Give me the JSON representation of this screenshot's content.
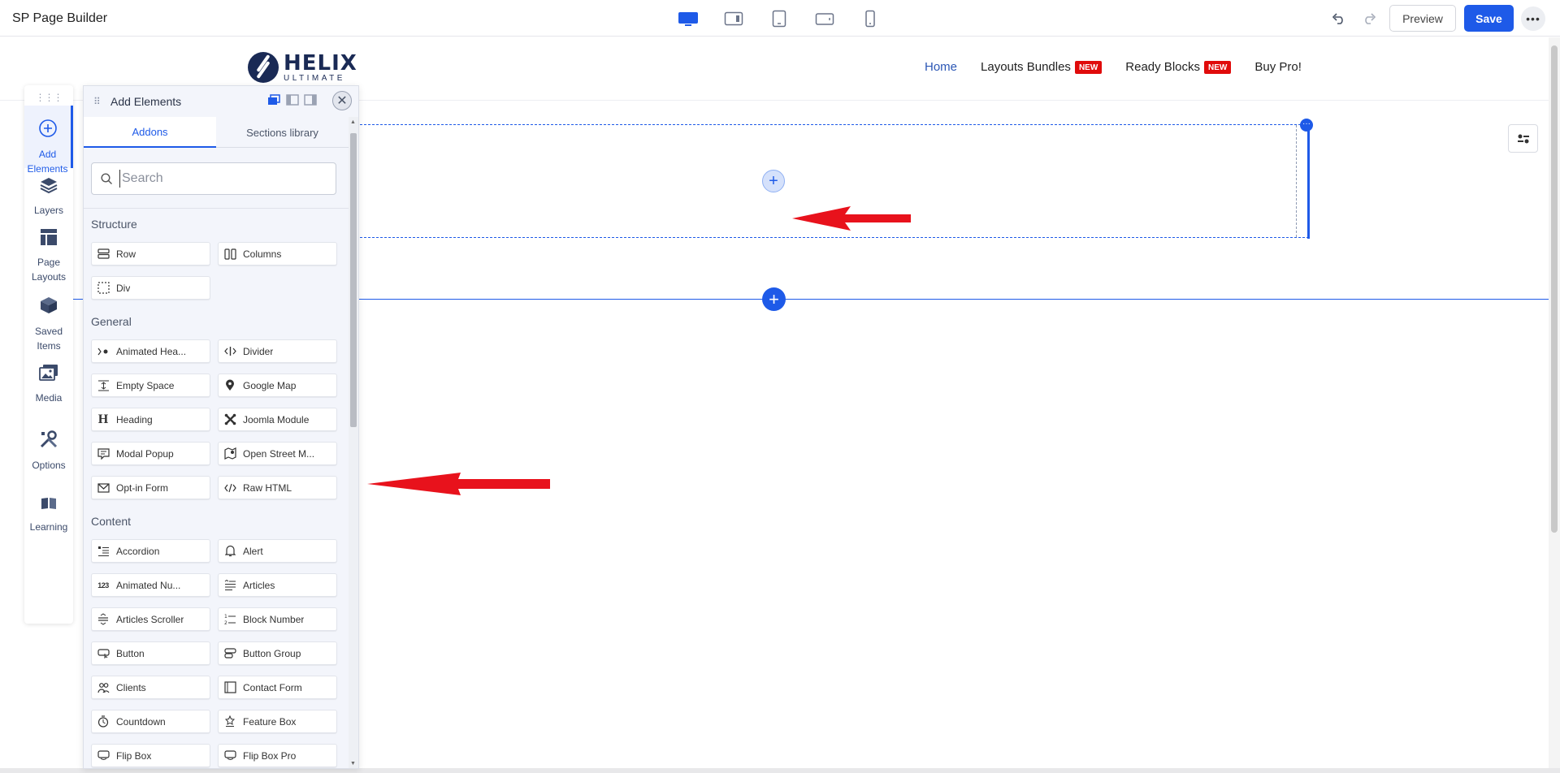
{
  "app": {
    "title": "SP Page Builder"
  },
  "toolbar": {
    "devices": [
      "desktop-icon",
      "laptop-icon",
      "tablet-icon",
      "tablet-landscape-icon",
      "mobile-icon"
    ],
    "undo_icon": "undo-icon",
    "redo_icon": "redo-icon",
    "preview_label": "Preview",
    "save_label": "Save",
    "more_label": "•••"
  },
  "site": {
    "logo": {
      "name": "HELIX",
      "subtitle": "ULTIMATE"
    },
    "nav": [
      {
        "label": "Home",
        "active": true,
        "badge": ""
      },
      {
        "label": "Layouts Bundles",
        "active": false,
        "badge": "NEW"
      },
      {
        "label": "Ready Blocks",
        "active": false,
        "badge": "NEW"
      },
      {
        "label": "Buy Pro!",
        "active": false,
        "badge": ""
      }
    ]
  },
  "rail": {
    "items": [
      {
        "label_lines": [
          "Add",
          "Elements"
        ],
        "icon": "plus-circle-icon",
        "active": true
      },
      {
        "label_lines": [
          "Layers"
        ],
        "icon": "layers-icon",
        "active": false
      },
      {
        "label_lines": [
          "Page",
          "Layouts"
        ],
        "icon": "page-layouts-icon",
        "active": false
      },
      {
        "label_lines": [
          "Saved",
          "Items"
        ],
        "icon": "box-icon",
        "active": false
      },
      {
        "label_lines": [
          "Media"
        ],
        "icon": "image-icon",
        "active": false
      },
      {
        "label_lines": [
          "Options"
        ],
        "icon": "tools-icon",
        "active": false
      },
      {
        "label_lines": [
          "Learning"
        ],
        "icon": "book-icon",
        "active": false
      }
    ]
  },
  "panel": {
    "title": "Add Elements",
    "tabs": [
      {
        "label": "Addons",
        "active": true
      },
      {
        "label": "Sections library",
        "active": false
      }
    ],
    "search": {
      "placeholder": "Search",
      "value": ""
    },
    "categories": [
      {
        "title": "Structure",
        "items": [
          {
            "label": "Row",
            "icon": "row-icon"
          },
          {
            "label": "Columns",
            "icon": "columns-icon"
          },
          {
            "label": "Div",
            "icon": "div-icon"
          }
        ]
      },
      {
        "title": "General",
        "items": [
          {
            "label": "Animated Hea...",
            "icon": "animated-heading-icon"
          },
          {
            "label": "Divider",
            "icon": "divider-icon"
          },
          {
            "label": "Empty Space",
            "icon": "empty-space-icon"
          },
          {
            "label": "Google Map",
            "icon": "map-pin-icon"
          },
          {
            "label": "Heading",
            "icon": "heading-icon"
          },
          {
            "label": "Joomla Module",
            "icon": "joomla-icon"
          },
          {
            "label": "Modal Popup",
            "icon": "modal-icon"
          },
          {
            "label": "Open Street M...",
            "icon": "street-map-icon"
          },
          {
            "label": "Opt-in Form",
            "icon": "envelope-icon"
          },
          {
            "label": "Raw HTML",
            "icon": "code-icon"
          }
        ]
      },
      {
        "title": "Content",
        "items": [
          {
            "label": "Accordion",
            "icon": "accordion-icon"
          },
          {
            "label": "Alert",
            "icon": "bell-icon"
          },
          {
            "label": "Animated Nu...",
            "icon": "animated-number-icon"
          },
          {
            "label": "Articles",
            "icon": "articles-icon"
          },
          {
            "label": "Articles Scroller",
            "icon": "articles-scroller-icon"
          },
          {
            "label": "Block Number",
            "icon": "block-number-icon"
          },
          {
            "label": "Button",
            "icon": "button-icon"
          },
          {
            "label": "Button Group",
            "icon": "button-group-icon"
          },
          {
            "label": "Clients",
            "icon": "clients-icon"
          },
          {
            "label": "Contact Form",
            "icon": "contact-form-icon"
          },
          {
            "label": "Countdown",
            "icon": "countdown-icon"
          },
          {
            "label": "Feature Box",
            "icon": "feature-box-icon"
          },
          {
            "label": "Flip Box",
            "icon": "flip-box-icon"
          },
          {
            "label": "Flip Box Pro",
            "icon": "flip-box-pro-icon"
          }
        ]
      }
    ]
  },
  "colors": {
    "accent": "#1e5ae8",
    "badge": "#e00b0b",
    "arrow": "#e8121c"
  }
}
